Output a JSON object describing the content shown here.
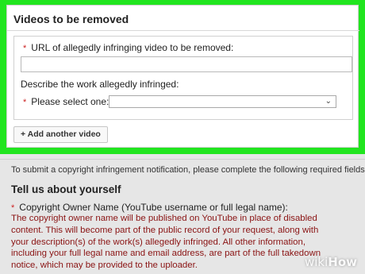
{
  "videos_panel": {
    "title": "Videos to be removed",
    "url_label": "URL of allegedly infringing video to be removed:",
    "url_value": "",
    "describe_label": "Describe the work allegedly infringed:",
    "select_label": "Please select one:",
    "select_value": "",
    "chevron_icon": "chevron-down-icon",
    "add_button": "+ Add another video",
    "required_marker": "*",
    "highlight_color": "#21e51f"
  },
  "about": {
    "notice": "To submit a copyright infringement notification, please complete the following required fields.",
    "heading": "Tell us about yourself",
    "owner_label": "Copyright Owner Name (YouTube username or full legal name):",
    "required_marker": "*",
    "disclaimer_lines": [
      "The copyright owner name will be published on YouTube in place of disabled",
      "content. This will become part of the public record of your request, along with",
      "your description(s) of the work(s) allegedly infringed. All other information,",
      "including your full legal name and email address, are part of the full takedown",
      "notice, which may be provided to the uploader."
    ]
  },
  "watermark": {
    "prefix": "wiki",
    "suffix": "How"
  }
}
